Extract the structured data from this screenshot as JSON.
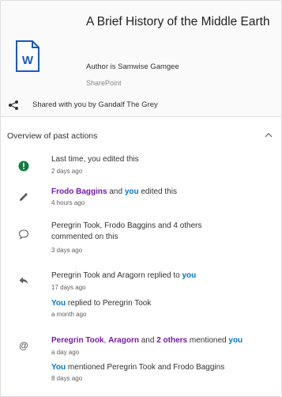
{
  "file": {
    "title": "A Brief History of the Middle Earth",
    "author": "Author is Samwise Gamgee",
    "site": "SharePoint",
    "icon": "word-document-icon",
    "icon_letter": "W",
    "icon_color": "#185abd"
  },
  "share": {
    "icon": "share-icon",
    "text": "Shared with you by Gandalf The Grey"
  },
  "section": {
    "title": "Overview of past actions",
    "toggle_icon": "chevron-up-icon"
  },
  "actions": [
    {
      "icon": "alert-circle-icon",
      "text": "Last time, you edited this",
      "time": "2 days ago"
    },
    {
      "icon": "pencil-icon",
      "actor": "Frodo Baggins",
      "mid": " and ",
      "you": "you",
      "rest": " edited this",
      "time": "4 hours ago"
    },
    {
      "icon": "comment-icon",
      "text1": "Peregrin Took, Frodo Baggins and 4 others",
      "text2": "commented on this",
      "time": "3 days ago"
    },
    {
      "icon": "reply-icon",
      "text": "Peregrin Took and Aragorn replied to ",
      "you": "you",
      "time": "17 days ago",
      "sub_you": "You",
      "sub_text": " replied to Peregrin Took",
      "sub_time": "a month ago"
    },
    {
      "icon": "at-mention-icon",
      "a1": "Peregrin Took",
      "sep1": ", ",
      "a2": "Aragorn",
      "sep2": " and ",
      "a3": "2 others",
      "mid": " mentioned ",
      "you": "you",
      "time": "a day ago",
      "sub_you": "You",
      "sub_text": " mentioned Peregrin Took and Frodo Baggins",
      "sub_time": "8 days ago"
    }
  ]
}
